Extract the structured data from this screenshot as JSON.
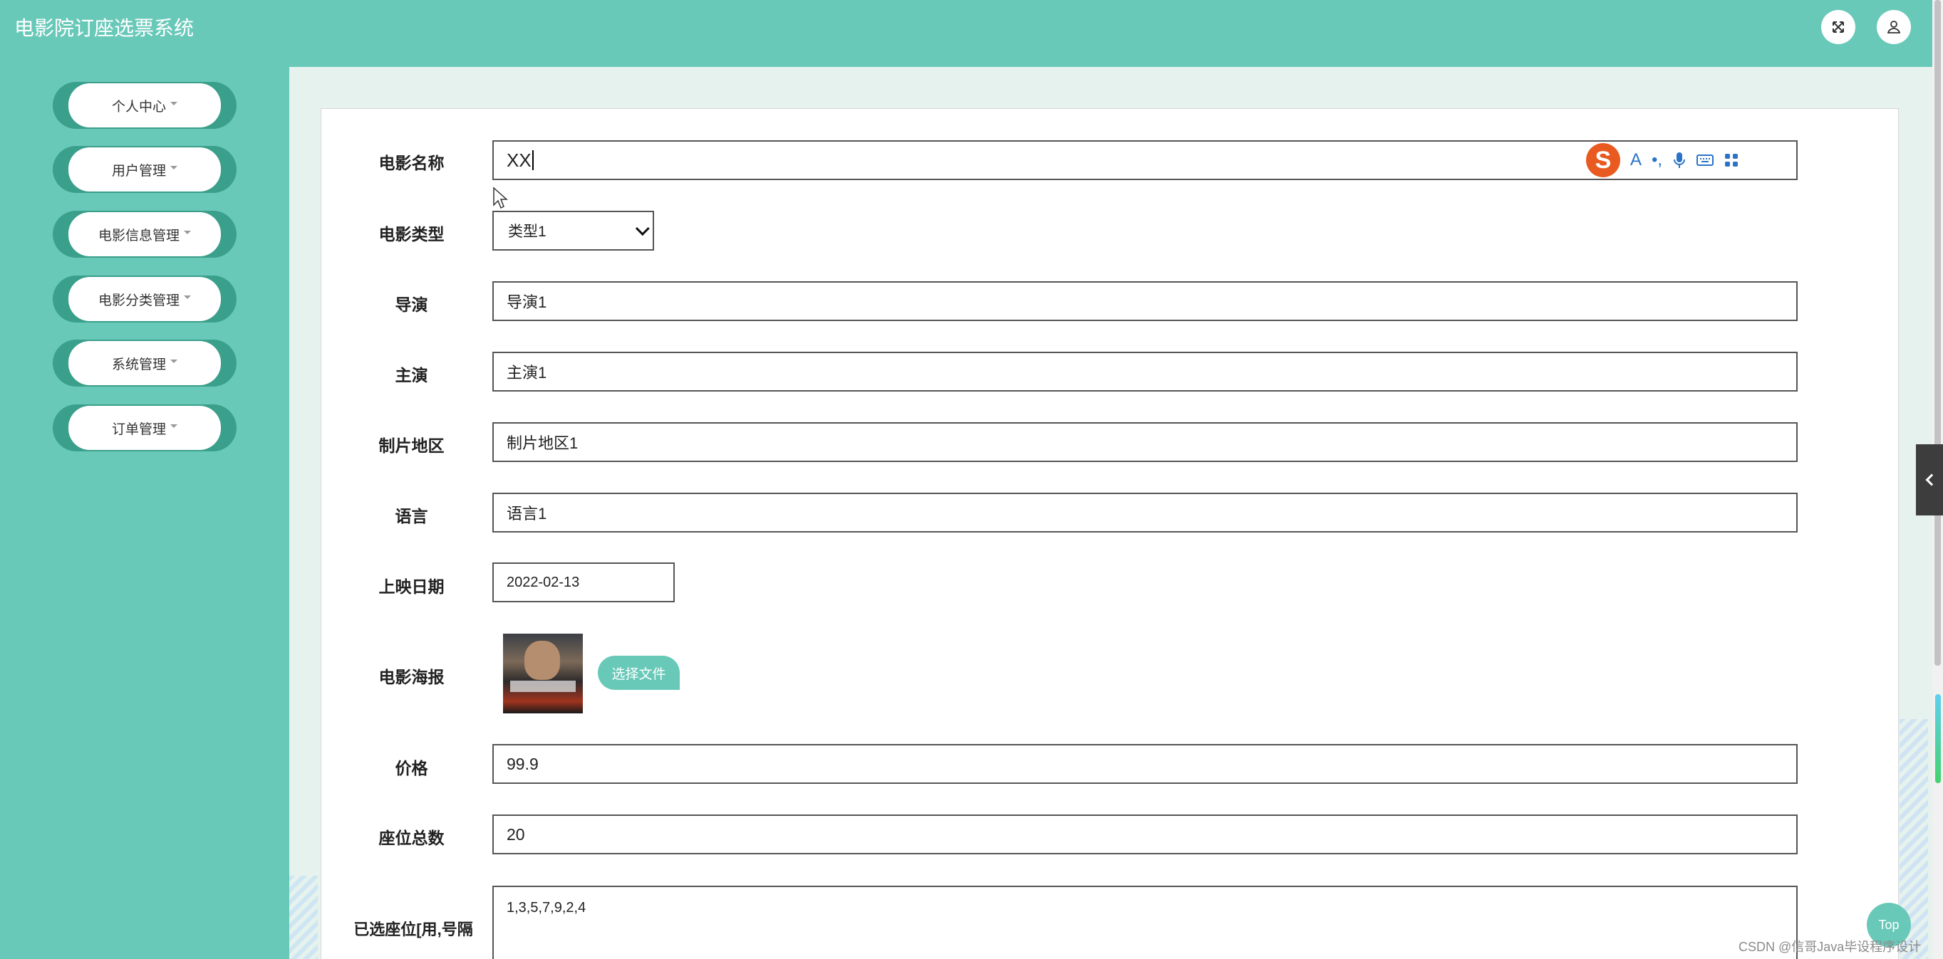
{
  "app": {
    "title": "电影院订座选票系统"
  },
  "header": {
    "icons": [
      "fullscreen-icon",
      "user-icon"
    ]
  },
  "sidebar": {
    "items": [
      {
        "label": "个人中心"
      },
      {
        "label": "用户管理"
      },
      {
        "label": "电影信息管理"
      },
      {
        "label": "电影分类管理"
      },
      {
        "label": "系统管理"
      },
      {
        "label": "订单管理"
      }
    ]
  },
  "form": {
    "movie_name": {
      "label": "电影名称",
      "value": "XX"
    },
    "movie_type": {
      "label": "电影类型",
      "value": "类型1"
    },
    "director": {
      "label": "导演",
      "value": "导演1"
    },
    "actors": {
      "label": "主演",
      "value": "主演1"
    },
    "region": {
      "label": "制片地区",
      "value": "制片地区1"
    },
    "language": {
      "label": "语言",
      "value": "语言1"
    },
    "release_date": {
      "label": "上映日期",
      "value": "2022-02-13"
    },
    "poster": {
      "label": "电影海报",
      "button": "选择文件"
    },
    "price": {
      "label": "价格",
      "value": "99.9"
    },
    "total_seats": {
      "label": "座位总数",
      "value": "20"
    },
    "selected_seats": {
      "label": "已选座位[用,号隔",
      "value": "1,3,5,7,9,2,4"
    }
  },
  "ime_toolbar": {
    "logo": "S",
    "icons": [
      "font-a-icon",
      "punctuation-icon",
      "microphone-icon",
      "keyboard-icon",
      "apps-grid-icon"
    ]
  },
  "top_button": {
    "label": "Top"
  },
  "watermark": {
    "text": "CSDN @信哥Java毕设程序设计"
  },
  "colors": {
    "primary": "#69c9b9",
    "sidebar_pill": "#3a9f8b",
    "background": "#e6f2ee"
  }
}
